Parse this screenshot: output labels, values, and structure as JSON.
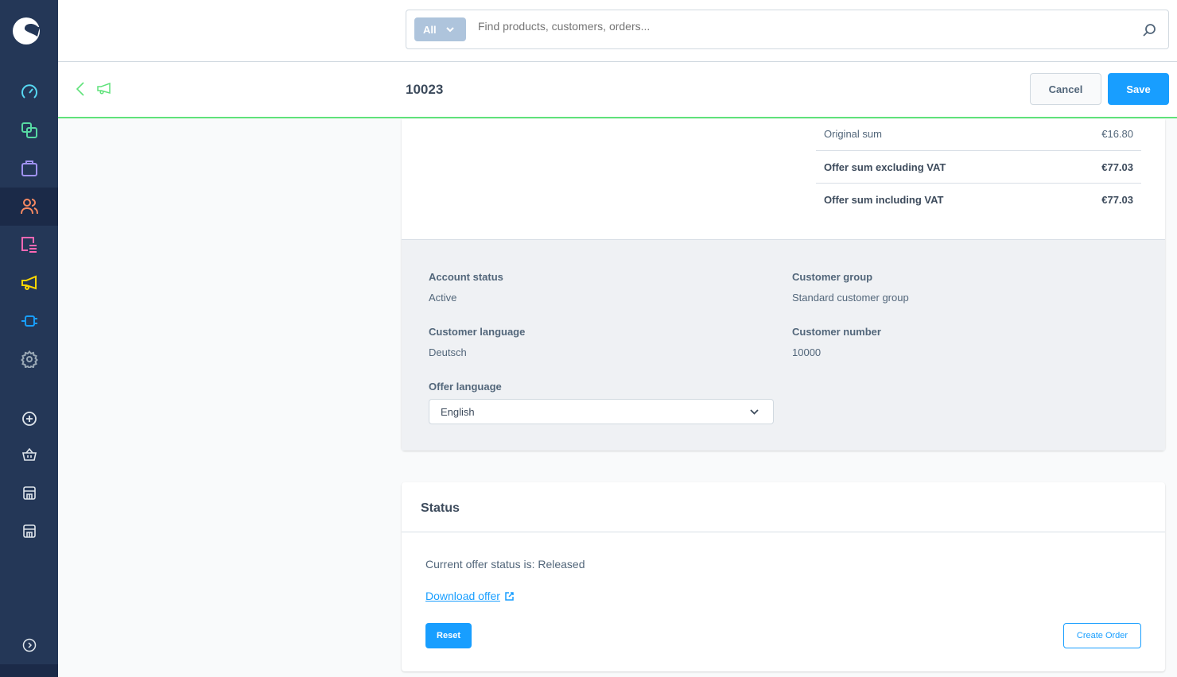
{
  "sidebar": {
    "items": [
      {
        "name": "dashboard",
        "icon": "gauge-icon",
        "color": "#57d9f3"
      },
      {
        "name": "catalogues",
        "icon": "products-icon",
        "color": "#57d9a3"
      },
      {
        "name": "orders",
        "icon": "shopping-bag-icon",
        "color": "#a092f0"
      },
      {
        "name": "customers",
        "icon": "users-icon",
        "color": "#f88962",
        "active": true
      },
      {
        "name": "content",
        "icon": "content-icon",
        "color": "#ff68b4"
      },
      {
        "name": "marketing",
        "icon": "megaphone-icon",
        "color": "#ffd700"
      },
      {
        "name": "extensions",
        "icon": "plug-icon",
        "color": "#189eff"
      },
      {
        "name": "settings",
        "icon": "gear-icon",
        "color": "#9aa8b5"
      }
    ],
    "secondary": [
      "plus-circle-icon",
      "basket-icon",
      "storefront-icon",
      "storefront-icon"
    ]
  },
  "search": {
    "type": "All",
    "placeholder": "Find products, customers, orders..."
  },
  "header": {
    "title": "10023",
    "cancel": "Cancel",
    "save": "Save"
  },
  "summary": [
    {
      "label": "Original sum",
      "value": "€16.80",
      "bold": false
    },
    {
      "label": "Offer sum excluding VAT",
      "value": "€77.03",
      "bold": true
    },
    {
      "label": "Offer sum including VAT",
      "value": "€77.03",
      "bold": true
    }
  ],
  "details": {
    "account_status_label": "Account status",
    "account_status": "Active",
    "customer_group_label": "Customer group",
    "customer_group": "Standard customer group",
    "language_label": "Customer language",
    "language": "Deutsch",
    "number_label": "Customer number",
    "number": "10000",
    "offer_language_label": "Offer language",
    "offer_language": "English"
  },
  "status": {
    "title": "Status",
    "text": "Current offer status is: Released",
    "download": "Download offer",
    "reset": "Reset",
    "create_order": "Create Order"
  },
  "colors": {
    "accent": "#189eff",
    "success": "#5fe27a",
    "sidebar": "#243757"
  }
}
